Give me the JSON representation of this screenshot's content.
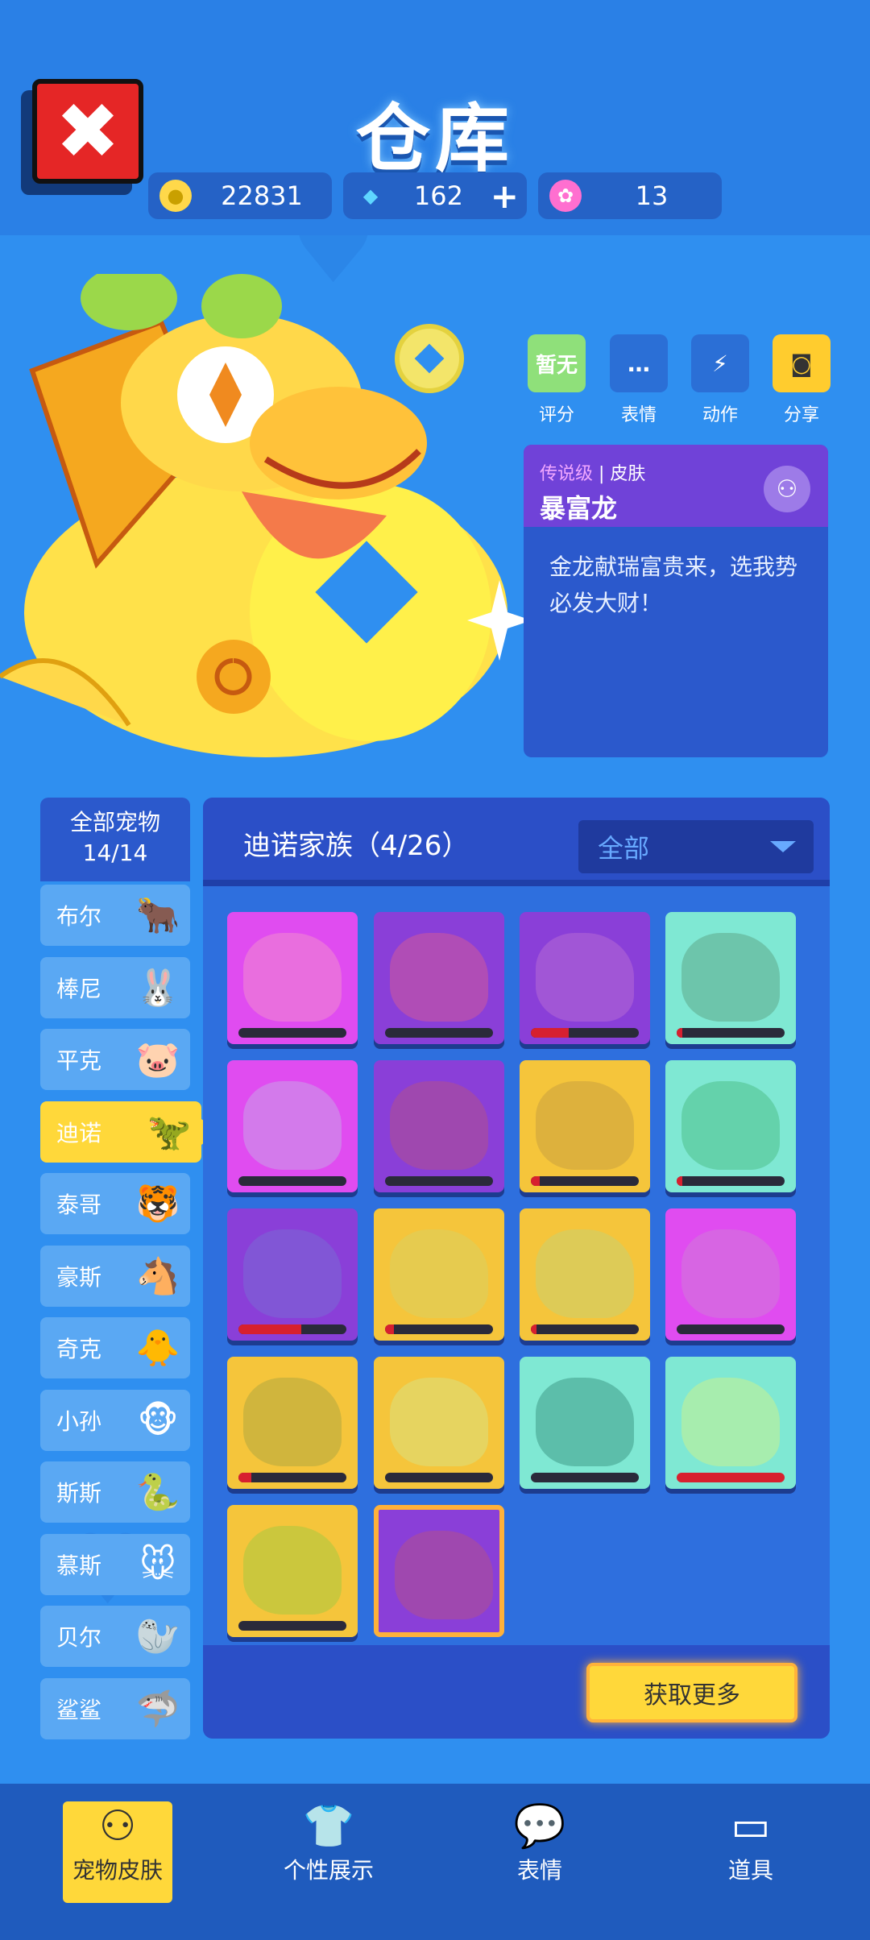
{
  "header": {
    "title": "仓库",
    "close_icon": "✖",
    "currencies": [
      {
        "icon": "coin-icon",
        "value": "22831",
        "color": "#ffd84a"
      },
      {
        "icon": "diamond-icon",
        "value": "162",
        "plus": "+",
        "color": "#5fd6ff"
      },
      {
        "icon": "lotus-icon",
        "value": "13",
        "color": "#ff6fd0"
      }
    ]
  },
  "actions": [
    {
      "label": "评分",
      "box_text": "暂无",
      "color": "#8fe07a"
    },
    {
      "label": "表情",
      "box_text": "💬",
      "color": "#2f8ff0"
    },
    {
      "label": "动作",
      "box_text": "🏃",
      "color": "#2f8ff0"
    },
    {
      "label": "分享",
      "box_text": "📷",
      "color": "#ffcc2e"
    }
  ],
  "skin_info": {
    "rarity": "传说级",
    "type": "皮肤",
    "name": "暴富龙",
    "description": "金龙献瑞富贵来，选我势必发大财！"
  },
  "sidebar": {
    "header_line1": "全部宠物",
    "header_line2": "14/14",
    "items": [
      {
        "label": "布尔",
        "pet": "🐂"
      },
      {
        "label": "棒尼",
        "pet": "🐰"
      },
      {
        "label": "平克",
        "pet": "🐷"
      },
      {
        "label": "迪诺",
        "pet": "🦖",
        "active": true
      },
      {
        "label": "泰哥",
        "pet": "🐯"
      },
      {
        "label": "豪斯",
        "pet": "🐴"
      },
      {
        "label": "奇克",
        "pet": "🐥"
      },
      {
        "label": "小孙",
        "pet": "🐵"
      },
      {
        "label": "斯斯",
        "pet": "🐍"
      },
      {
        "label": "慕斯",
        "pet": "🐭"
      },
      {
        "label": "贝尔",
        "pet": "🦭"
      },
      {
        "label": "鲨鲨",
        "pet": "🦈"
      }
    ]
  },
  "panel": {
    "title": "迪诺家族（4/26）",
    "filter": "全部",
    "get_more": "获取更多",
    "tiles": [
      {
        "bg": "#e04cf0",
        "face": "#f08ad0",
        "progress": 0
      },
      {
        "bg": "#8a3fd8",
        "face": "#d05a9a",
        "progress": 0
      },
      {
        "bg": "#8a3fd8",
        "face": "#b46ad6",
        "progress": 0.35
      },
      {
        "bg": "#7fe8d3",
        "face": "#5fa88a",
        "progress": 0.05
      },
      {
        "bg": "#e04cf0",
        "face": "#c9a0e8",
        "progress": 0
      },
      {
        "bg": "#8a3fd8",
        "face": "#b0508e",
        "progress": 0
      },
      {
        "bg": "#f5c53b",
        "face": "#c9a040",
        "progress": 0.08
      },
      {
        "bg": "#7fe8d3",
        "face": "#4fbf8a",
        "progress": 0.05
      },
      {
        "bg": "#8a3fd8",
        "face": "#7a6ad6",
        "progress": 0.58
      },
      {
        "bg": "#f5c53b",
        "face": "#d9d060",
        "progress": 0.08
      },
      {
        "bg": "#f5c53b",
        "face": "#c9d070",
        "progress": 0.05
      },
      {
        "bg": "#e04cf0",
        "face": "#d07ad8",
        "progress": 0
      },
      {
        "bg": "#f5c53b",
        "face": "#b0a840",
        "progress": 0.12
      },
      {
        "bg": "#f5c53b",
        "face": "#d9e080",
        "progress": 0
      },
      {
        "bg": "#7fe8d3",
        "face": "#3f9a88",
        "progress": 0
      },
      {
        "bg": "#7fe8d3",
        "face": "#c9f090",
        "progress": 1
      },
      {
        "bg": "#f5c53b",
        "face": "#a8c840",
        "progress": 0
      },
      {
        "bg": "#8a3fd8",
        "face": "#b0508e",
        "progress": 0,
        "selected": true
      }
    ]
  },
  "bottom_nav": [
    {
      "label": "宠物皮肤",
      "icon": "pet-skin-icon",
      "glyph": "⚇",
      "active": true
    },
    {
      "label": "个性展示",
      "icon": "shirt-icon",
      "glyph": "👕"
    },
    {
      "label": "表情",
      "icon": "emote-icon",
      "glyph": "💬"
    },
    {
      "label": "道具",
      "icon": "card-icon",
      "glyph": "▭"
    }
  ]
}
